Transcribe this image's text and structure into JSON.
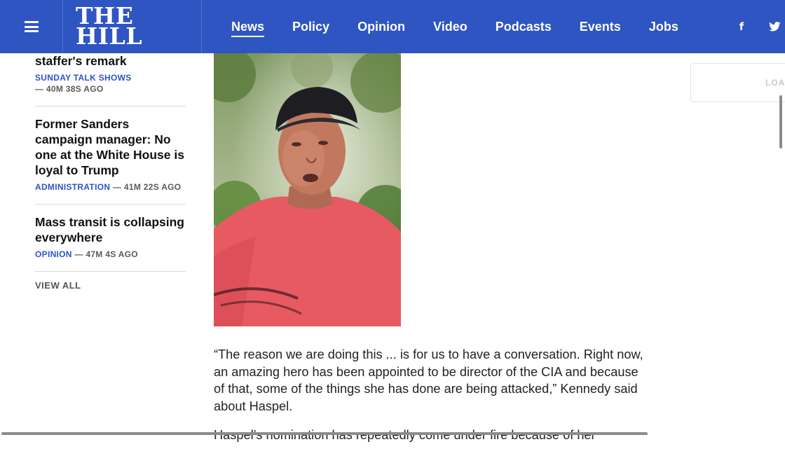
{
  "header": {
    "logo_line1": "THE",
    "logo_line2": "HILL",
    "nav": [
      {
        "label": "News",
        "active": true
      },
      {
        "label": "Policy"
      },
      {
        "label": "Opinion"
      },
      {
        "label": "Video"
      },
      {
        "label": "Podcasts"
      },
      {
        "label": "Events"
      },
      {
        "label": "Jobs"
      }
    ],
    "social": {
      "facebook": "f"
    },
    "brand_color": "#2e55c2"
  },
  "sidebar": {
    "items": [
      {
        "title": "staffer's remark",
        "category": "SUNDAY TALK SHOWS",
        "time": "— 40M 38S AGO"
      },
      {
        "title": "Former Sanders campaign manager: No one at the White House is loyal to Trump",
        "category": "ADMINISTRATION",
        "time": "— 41M 22S AGO"
      },
      {
        "title": "Mass transit is collapsing everywhere",
        "category": "OPINION",
        "time": "— 47M 4S AGO"
      }
    ],
    "view_all": "VIEW ALL"
  },
  "article": {
    "paragraphs": [
      "“The reason we are doing this ... is for us to have a conversation. Right now, an amazing hero has been appointed to be director of the CIA and because of that, some of the things she has done are being attacked,” Kennedy said about Haspel.",
      "Haspel’s nomination has repeatedly come under fire because of her"
    ]
  },
  "ad": {
    "loading_text": "LOA"
  }
}
